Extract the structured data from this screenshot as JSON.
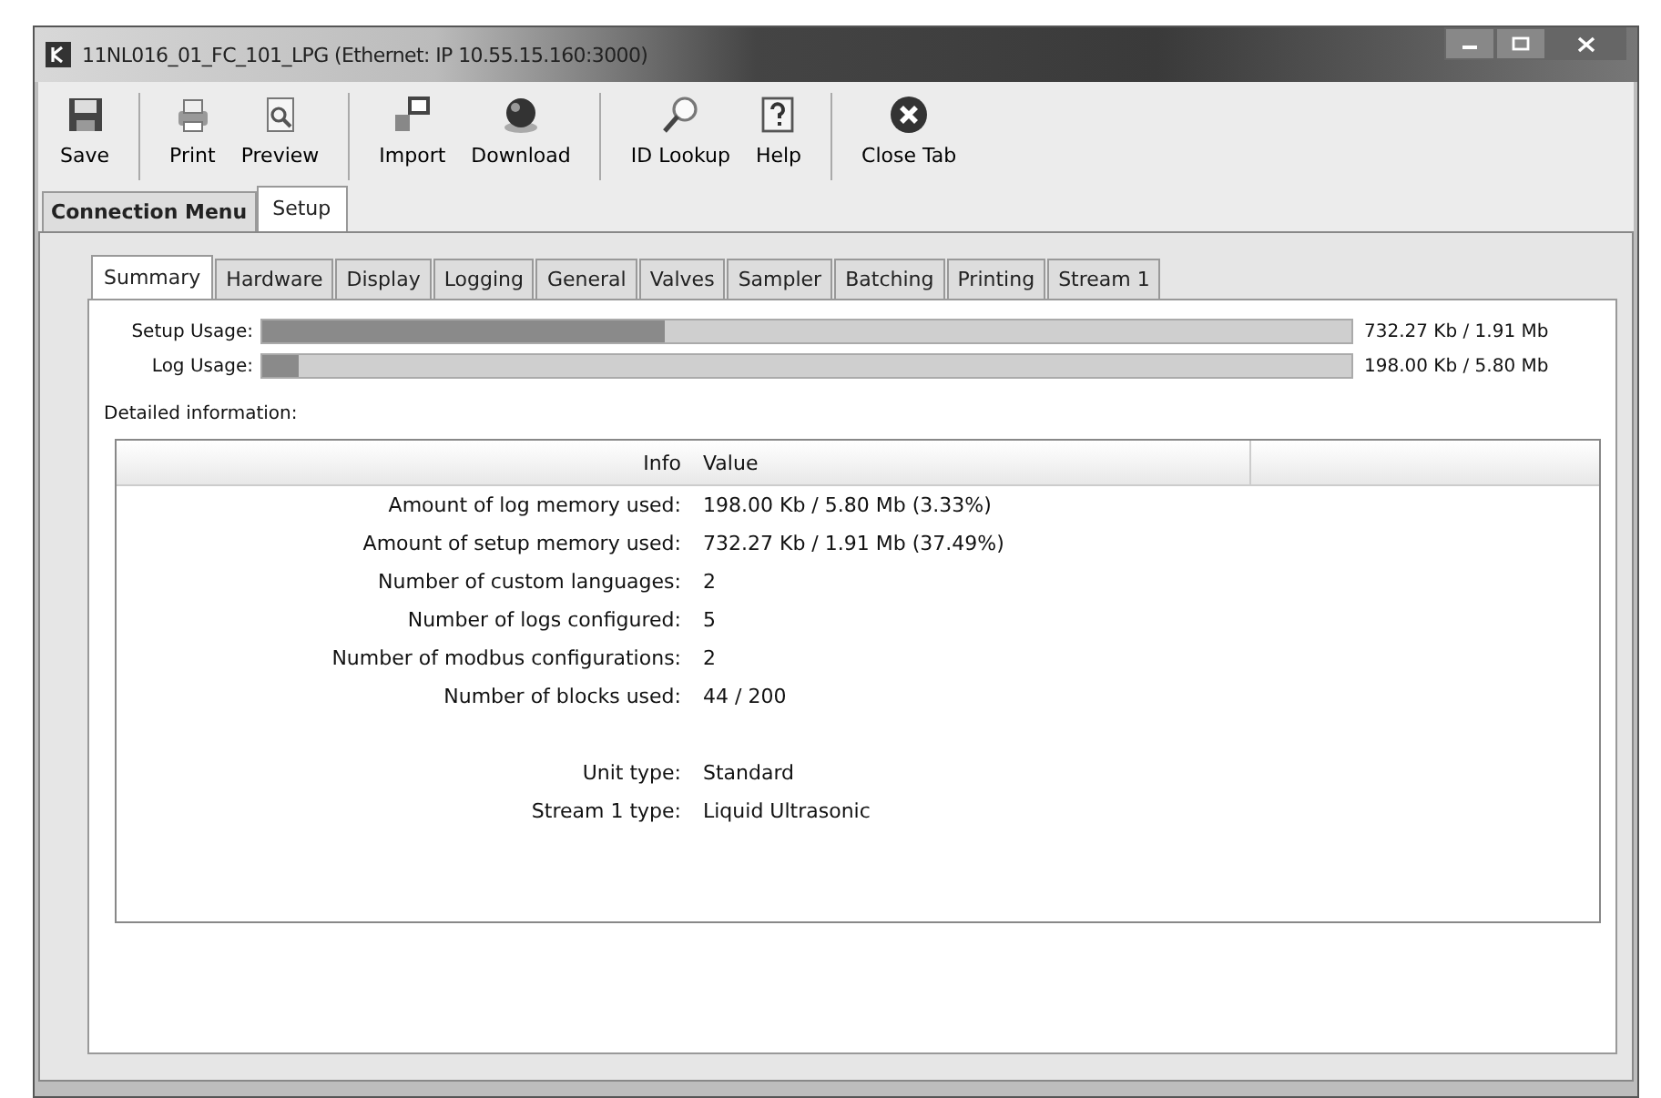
{
  "window": {
    "title": "11NL016_01_FC_101_LPG (Ethernet: IP 10.55.15.160:3000)"
  },
  "toolbar_groups": [
    [
      "Save"
    ],
    [
      "Print",
      "Preview"
    ],
    [
      "Import",
      "Download"
    ],
    [
      "ID Lookup",
      "Help"
    ],
    [
      "Close Tab"
    ]
  ],
  "outer_tabs": [
    {
      "label": "Connection Menu",
      "selected": false
    },
    {
      "label": "Setup",
      "selected": true
    }
  ],
  "inner_tabs": [
    {
      "label": "Summary",
      "selected": true
    },
    {
      "label": "Hardware",
      "selected": false
    },
    {
      "label": "Display",
      "selected": false
    },
    {
      "label": "Logging",
      "selected": false
    },
    {
      "label": "General",
      "selected": false
    },
    {
      "label": "Valves",
      "selected": false
    },
    {
      "label": "Sampler",
      "selected": false
    },
    {
      "label": "Batching",
      "selected": false
    },
    {
      "label": "Printing",
      "selected": false
    },
    {
      "label": "Stream 1",
      "selected": false
    }
  ],
  "usage": [
    {
      "label": "Setup Usage:",
      "level": 0.37,
      "reading": "732.27 Kb / 1.91 Mb"
    },
    {
      "label": "Log Usage:",
      "level": 0.033,
      "reading": "198.00 Kb / 5.80 Mb"
    }
  ],
  "details": {
    "label": "Detailed information:",
    "columns": [
      "Info",
      "Value"
    ],
    "row_groups": [
      [
        {
          "info": "Amount of log memory used:",
          "value": "198.00 Kb / 5.80 Mb (3.33%)"
        },
        {
          "info": "Amount of setup memory used:",
          "value": "732.27 Kb / 1.91 Mb (37.49%)"
        },
        {
          "info": "Number of custom languages:",
          "value": "2"
        },
        {
          "info": "Number of logs configured:",
          "value": "5"
        },
        {
          "info": "Number of modbus configurations:",
          "value": "2"
        },
        {
          "info": "Number of blocks used:",
          "value": "44 / 200"
        }
      ],
      [
        {
          "info": "Unit type:",
          "value": "Standard"
        },
        {
          "info": "Stream 1 type:",
          "value": "Liquid Ultrasonic"
        }
      ]
    ]
  }
}
